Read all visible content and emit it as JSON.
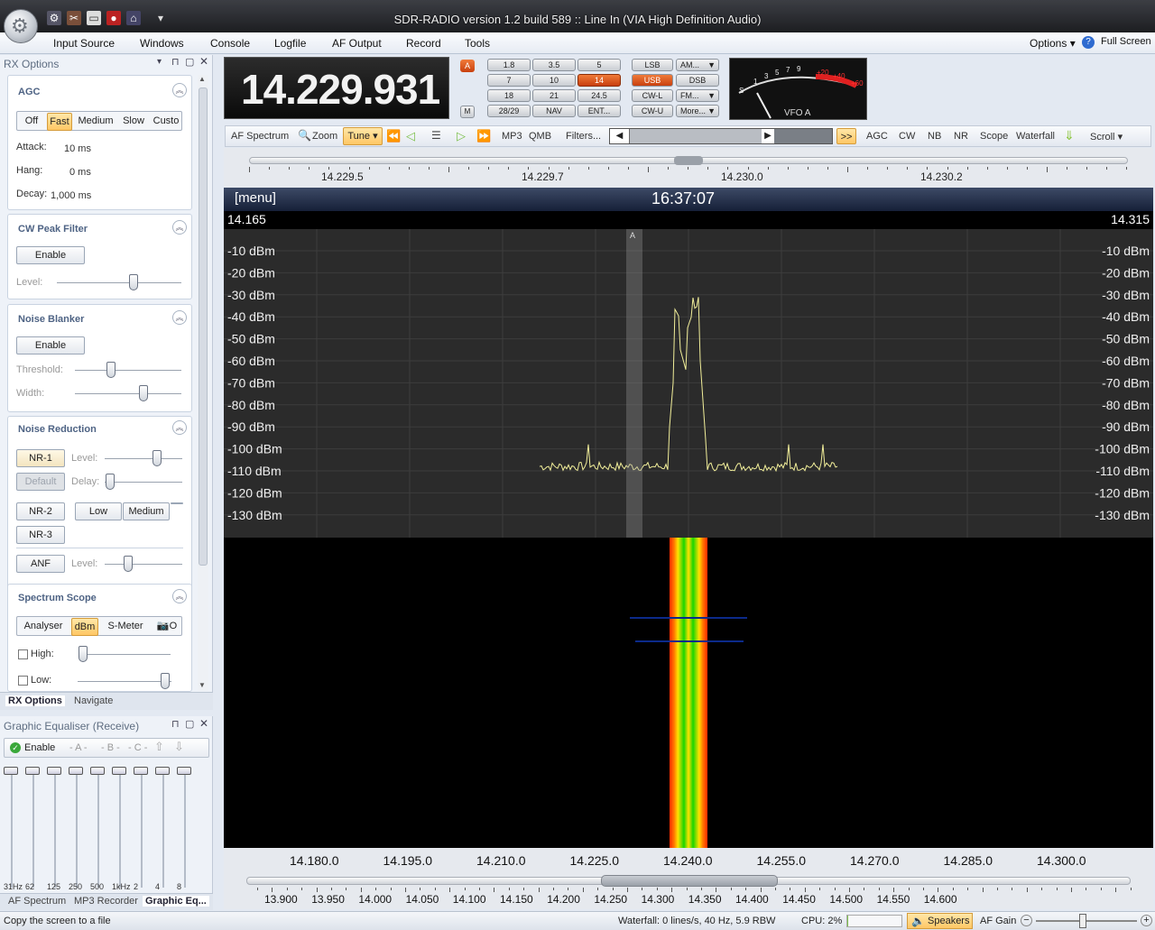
{
  "app": {
    "title": "SDR-RADIO version 1.2  build 589 :: Line In (VIA High Definition Audio)"
  },
  "menu": {
    "items": [
      "Input Source",
      "Windows",
      "Console",
      "Logfile",
      "AF Output",
      "Record",
      "Tools"
    ],
    "options": "Options",
    "fullscreen": "Full Screen"
  },
  "rx": {
    "title": "RX Options",
    "agc": {
      "heading": "AGC",
      "modes": [
        "Off",
        "Fast",
        "Medium",
        "Slow",
        "Custo"
      ],
      "selected": "Fast",
      "attack_label": "Attack:",
      "attack": "10 ms",
      "hang_label": "Hang:",
      "hang": "0 ms",
      "decay_label": "Decay:",
      "decay": "1,000 ms"
    },
    "cw": {
      "heading": "CW Peak Filter",
      "enable": "Enable",
      "level": "Level:"
    },
    "nb": {
      "heading": "Noise Blanker",
      "enable": "Enable",
      "threshold": "Threshold:",
      "width": "Width:"
    },
    "nr": {
      "heading": "Noise Reduction",
      "nr1": "NR-1",
      "level": "Level:",
      "default": "Default",
      "delay": "Delay:",
      "nr2": "NR-2",
      "low": "Low",
      "medium": "Medium",
      "nr3": "NR-3",
      "anf": "ANF",
      "anf_level": "Level:"
    },
    "scope": {
      "heading": "Spectrum Scope",
      "tabs": [
        "Analyser",
        "dBm",
        "S-Meter",
        "O"
      ],
      "selected": "dBm",
      "high": "High:",
      "low": "Low:"
    },
    "bottom_tabs": [
      "RX Options",
      "Navigate"
    ]
  },
  "eq": {
    "title": "Graphic Equaliser (Receive)",
    "enable": "Enable",
    "presets": [
      "- A -",
      "- B -",
      "- C -"
    ],
    "bands": [
      "31Hz",
      "62",
      "125",
      "250",
      "500",
      "1kHz",
      "2",
      "4",
      "8"
    ],
    "levels": [
      0,
      0,
      0,
      0,
      0,
      0,
      0,
      0,
      0
    ]
  },
  "left_bottom_tabs": [
    "AF Spectrum",
    "MP3 Recorder",
    "Graphic Eq..."
  ],
  "radio": {
    "frequency": "14.229.931",
    "a_label": "A",
    "m_label": "M",
    "bands": [
      "1.8",
      "3.5",
      "5",
      "7",
      "10",
      "14",
      "18",
      "21",
      "24.5",
      "28/29",
      "NAV",
      "ENT..."
    ],
    "selected_band": "14",
    "modes": [
      "LSB",
      "AM...",
      "USB",
      "DSB",
      "CW-L",
      "FM...",
      "CW-U",
      "More..."
    ],
    "selected_mode": "USB",
    "vfo": "VFO A",
    "meter_scale": [
      "S",
      "1",
      "3",
      "5",
      "7",
      "9",
      "+20",
      "+40",
      "+60"
    ]
  },
  "toolbar": {
    "items": [
      "AF Spectrum",
      "Zoom",
      "Tune",
      "MP3",
      "QMB",
      "Filters...",
      "AGC",
      "CW",
      "NB",
      "NR",
      "Scope",
      "Waterfall",
      "Scroll"
    ],
    "ff": ">>"
  },
  "tune_scale": [
    "14.229.5",
    "14.229.7",
    "14.230.0",
    "14.230.2"
  ],
  "spectrum": {
    "menu": "[menu]",
    "time": "16:37:07",
    "left_freq": "14.165",
    "right_freq": "14.315",
    "marker": "A",
    "dbm_labels": [
      "-10 dBm",
      "-20 dBm",
      "-30 dBm",
      "-40 dBm",
      "-50 dBm",
      "-60 dBm",
      "-70 dBm",
      "-80 dBm",
      "-90 dBm",
      "-100 dBm",
      "-110 dBm",
      "-120 dBm",
      "-130 dBm"
    ],
    "freq_labels": [
      "14.180.0",
      "14.195.0",
      "14.210.0",
      "14.225.0",
      "14.240.0",
      "14.255.0",
      "14.270.0",
      "14.285.0",
      "14.300.0"
    ],
    "wide_labels": [
      "13.900",
      "13.950",
      "14.000",
      "14.050",
      "14.100",
      "14.150",
      "14.200",
      "14.250",
      "14.300",
      "14.350",
      "14.400",
      "14.450",
      "14.500",
      "14.550",
      "14.600"
    ]
  },
  "status": {
    "left": "Copy the screen to a file",
    "waterfall": "Waterfall: 0 lines/s, 40 Hz, 5.9 RBW",
    "cpu": "CPU: 2%",
    "speakers": "Speakers",
    "afgain": "AF Gain"
  },
  "colors": {
    "accent": "#ffc765",
    "band_selected": "#d9541a",
    "trace": "#f2ef9a"
  }
}
